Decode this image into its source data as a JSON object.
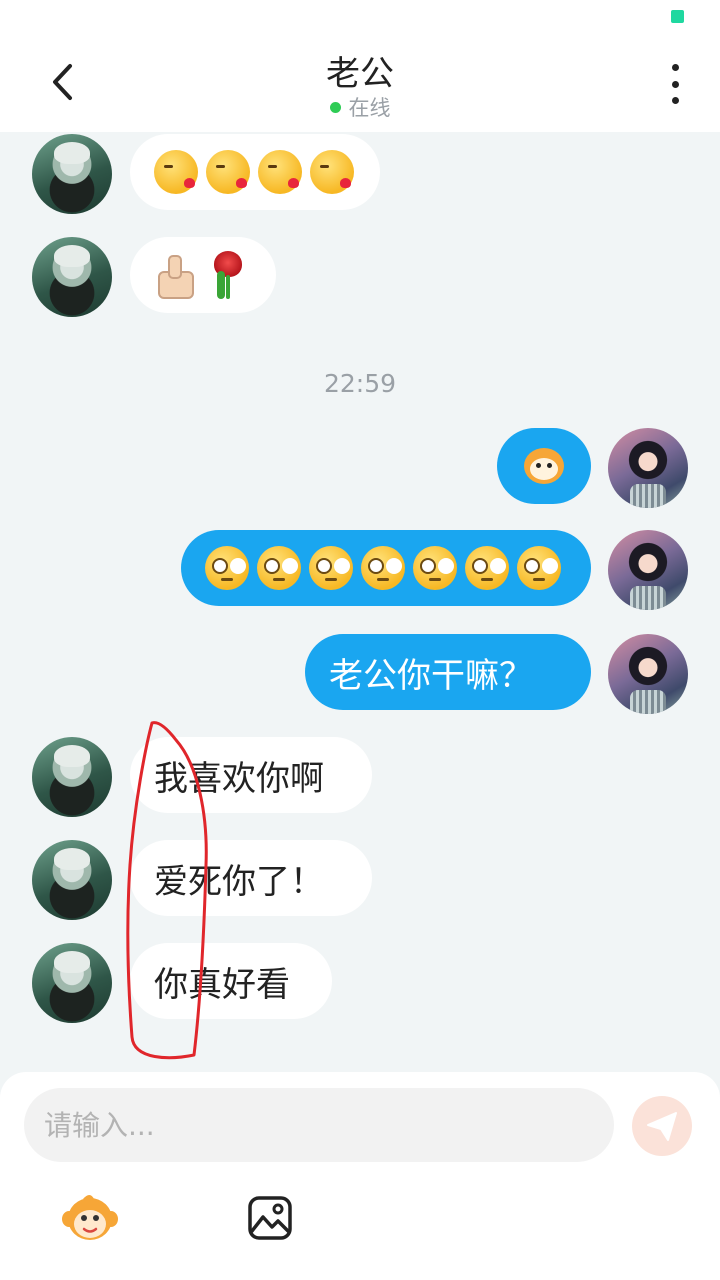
{
  "header": {
    "title": "老公",
    "status_text": "在线"
  },
  "chat": {
    "messages": [
      {
        "from": "partner",
        "type": "emoji",
        "content": [
          "kissing-heart-face",
          "kissing-heart-face",
          "kissing-heart-face",
          "kissing-heart-face"
        ]
      },
      {
        "from": "partner",
        "type": "emoji",
        "content": [
          "thumbs-up",
          "rose"
        ]
      },
      {
        "type": "timestamp",
        "text": "22:59"
      },
      {
        "from": "me",
        "type": "sticker",
        "content": [
          "monkey-sticker"
        ]
      },
      {
        "from": "me",
        "type": "emoji",
        "content": [
          "flushed-face",
          "flushed-face",
          "flushed-face",
          "flushed-face",
          "flushed-face",
          "flushed-face",
          "flushed-face"
        ]
      },
      {
        "from": "me",
        "type": "text",
        "text": "老公你干嘛？"
      },
      {
        "from": "partner",
        "type": "text",
        "text": "我喜欢你啊"
      },
      {
        "from": "partner",
        "type": "text",
        "text": "爱死你了！"
      },
      {
        "from": "partner",
        "type": "text",
        "text": "你真好看"
      }
    ],
    "annotation_color": "#e0262b"
  },
  "composer": {
    "placeholder": "请输入...",
    "send_icon": "send-icon",
    "tools": [
      "monkey-emoji-icon",
      "image-icon"
    ]
  },
  "colors": {
    "outgoing_bubble": "#1aa6f0",
    "incoming_bubble": "#ffffff",
    "chat_background": "#f1f5f6",
    "online_dot": "#2ecc55",
    "status_flag": "#1fd8a0"
  }
}
